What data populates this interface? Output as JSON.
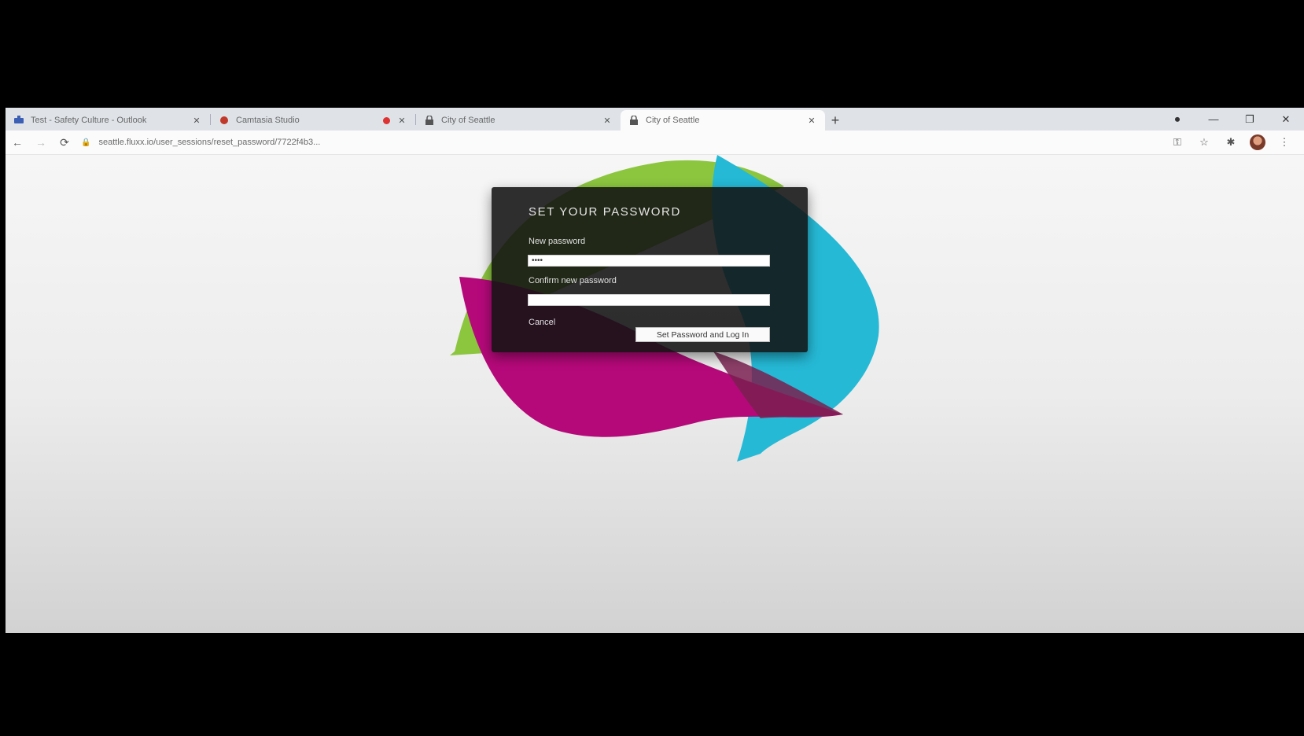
{
  "tabs": [
    {
      "favicon": "slack-icon",
      "label": "Test - Safety Culture - Outlook",
      "active": false
    },
    {
      "favicon": "presentation-icon",
      "label": "Camtasia Studio",
      "active": false,
      "recording": true
    },
    {
      "favicon": "lock-icon",
      "label": "City of Seattle",
      "active": false
    },
    {
      "favicon": "lock-icon",
      "label": "City of Seattle",
      "active": true
    }
  ],
  "toolbar": {
    "url": "seattle.fluxx.io/user_sessions/reset_password/7722f4b3...",
    "back": "←",
    "forward": "→",
    "reload": "⟳"
  },
  "window_controls": {
    "minimize": "—",
    "maximize": "❐",
    "close": "✕"
  },
  "form": {
    "title": "SET YOUR PASSWORD",
    "new_password_label": "New password",
    "new_password_value": "••••",
    "confirm_password_label": "Confirm new password",
    "confirm_password_value": "",
    "cancel_label": "Cancel",
    "submit_label": "Set Password and Log In"
  },
  "colors": {
    "green": "#8cc63f",
    "cyan": "#25b9d6",
    "magenta": "#b5097a",
    "card": "#121212"
  }
}
